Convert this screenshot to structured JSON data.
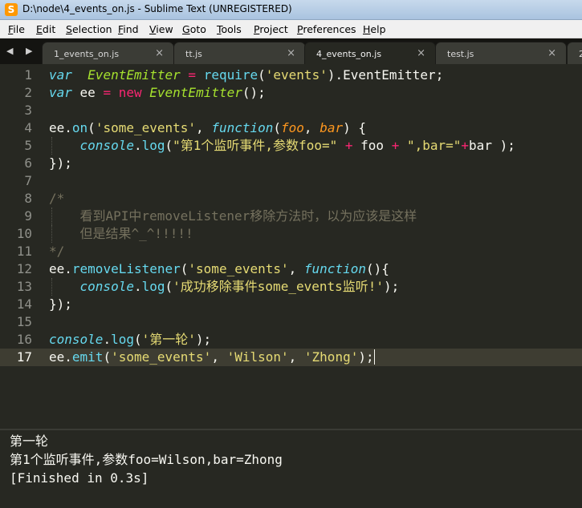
{
  "window": {
    "title": "D:\\node\\4_events_on.js - Sublime Text (UNREGISTERED)"
  },
  "menu": [
    {
      "mn": "F",
      "rest": "ile"
    },
    {
      "mn": "E",
      "rest": "dit"
    },
    {
      "mn": "S",
      "rest": "election"
    },
    {
      "mn": "F",
      "rest": "ind"
    },
    {
      "mn": "V",
      "rest": "iew"
    },
    {
      "mn": "G",
      "rest": "oto"
    },
    {
      "mn": "T",
      "rest": "ools"
    },
    {
      "mn": "P",
      "rest": "roject"
    },
    {
      "mn": "P",
      "rest": "references"
    },
    {
      "mn": "H",
      "rest": "elp"
    }
  ],
  "nav": {
    "arrows": "◀ ▶"
  },
  "tabs": [
    {
      "label": "1_events_on.js",
      "close": "×",
      "active": false
    },
    {
      "label": "tt.js",
      "close": "×",
      "active": false
    },
    {
      "label": "4_events_on.js",
      "close": "×",
      "active": true
    },
    {
      "label": "test.js",
      "close": "×",
      "active": false
    },
    {
      "label": "2",
      "close": "",
      "active": false
    }
  ],
  "editor": {
    "current_line": 17,
    "lines": [
      {
        "n": "1",
        "guide": false,
        "t": [
          [
            "kw",
            "var"
          ],
          [
            "",
            "  "
          ],
          [
            "cls",
            "EventEmitter"
          ],
          [
            "",
            "",
            " "
          ],
          [
            "op",
            "="
          ],
          [
            "",
            " "
          ],
          [
            "fn",
            "require"
          ],
          [
            "",
            "("
          ],
          [
            "str",
            "'events'"
          ],
          [
            "",
            ").EventEmitter;"
          ]
        ]
      },
      {
        "n": "2",
        "guide": false,
        "t": [
          [
            "kw",
            "var"
          ],
          [
            "",
            " ee "
          ],
          [
            "op",
            "="
          ],
          [
            "",
            " "
          ],
          [
            "op",
            "new"
          ],
          [
            "",
            " "
          ],
          [
            "cls",
            "EventEmitter"
          ],
          [
            "",
            "();"
          ]
        ]
      },
      {
        "n": "3",
        "guide": false,
        "t": []
      },
      {
        "n": "4",
        "guide": false,
        "t": [
          [
            "",
            "ee."
          ],
          [
            "fn",
            "on"
          ],
          [
            "",
            "("
          ],
          [
            "str",
            "'some_events'"
          ],
          [
            "",
            ", "
          ],
          [
            "kw",
            "function"
          ],
          [
            "",
            "("
          ],
          [
            "arg",
            "foo"
          ],
          [
            "",
            ", "
          ],
          [
            "arg",
            "bar"
          ],
          [
            "",
            ") {"
          ]
        ]
      },
      {
        "n": "5",
        "guide": true,
        "t": [
          [
            "",
            "    "
          ],
          [
            "kw",
            "console"
          ],
          [
            "",
            "."
          ],
          [
            "fn",
            "log"
          ],
          [
            "",
            "("
          ],
          [
            "str",
            "\"第1个监听事件,参数foo=\""
          ],
          [
            "",
            " "
          ],
          [
            "op",
            "+"
          ],
          [
            "",
            " foo "
          ],
          [
            "op",
            "+"
          ],
          [
            "",
            " "
          ],
          [
            "str",
            "\",bar=\""
          ],
          [
            "op",
            "+"
          ],
          [
            "",
            "bar );"
          ]
        ]
      },
      {
        "n": "6",
        "guide": false,
        "t": [
          [
            "",
            "});"
          ]
        ]
      },
      {
        "n": "7",
        "guide": false,
        "t": []
      },
      {
        "n": "8",
        "guide": false,
        "t": [
          [
            "cmt",
            "/*"
          ]
        ]
      },
      {
        "n": "9",
        "guide": true,
        "t": [
          [
            "cmt",
            "    看到API中removeListener移除方法时，以为应该是这样"
          ]
        ]
      },
      {
        "n": "10",
        "guide": true,
        "t": [
          [
            "cmt",
            "    但是结果^_^!!!!!"
          ]
        ]
      },
      {
        "n": "11",
        "guide": false,
        "t": [
          [
            "cmt",
            "*/"
          ]
        ]
      },
      {
        "n": "12",
        "guide": false,
        "t": [
          [
            "",
            "ee."
          ],
          [
            "fn",
            "removeListener"
          ],
          [
            "",
            "("
          ],
          [
            "str",
            "'some_events'"
          ],
          [
            "",
            ", "
          ],
          [
            "kw",
            "function"
          ],
          [
            "",
            "(){"
          ]
        ]
      },
      {
        "n": "13",
        "guide": true,
        "t": [
          [
            "",
            "    "
          ],
          [
            "kw",
            "console"
          ],
          [
            "",
            "."
          ],
          [
            "fn",
            "log"
          ],
          [
            "",
            "("
          ],
          [
            "str",
            "'成功移除事件some_events监听!'"
          ],
          [
            "",
            ");"
          ]
        ]
      },
      {
        "n": "14",
        "guide": false,
        "t": [
          [
            "",
            "});"
          ]
        ]
      },
      {
        "n": "15",
        "guide": false,
        "t": []
      },
      {
        "n": "16",
        "guide": false,
        "t": [
          [
            "kw",
            "console"
          ],
          [
            "",
            "."
          ],
          [
            "fn",
            "log"
          ],
          [
            "",
            "("
          ],
          [
            "str",
            "'第一轮'"
          ],
          [
            "",
            ");"
          ]
        ]
      },
      {
        "n": "17",
        "guide": false,
        "t": [
          [
            "",
            "ee."
          ],
          [
            "fn",
            "emit"
          ],
          [
            "",
            "("
          ],
          [
            "str",
            "'some_events'"
          ],
          [
            "",
            ", "
          ],
          [
            "str",
            "'Wilson'"
          ],
          [
            "",
            ", "
          ],
          [
            "str",
            "'Zhong'"
          ],
          [
            "",
            ");"
          ]
        ]
      }
    ]
  },
  "output": {
    "lines": [
      "第一轮",
      "第1个监听事件,参数foo=Wilson,bar=Zhong",
      "[Finished in 0.3s]"
    ]
  },
  "colors": {
    "background": "#272822",
    "keyword": "#66d9ef",
    "class": "#a6e22e",
    "operator": "#f92672",
    "string": "#e6db74",
    "argument": "#fd971f",
    "comment": "#75715e"
  }
}
